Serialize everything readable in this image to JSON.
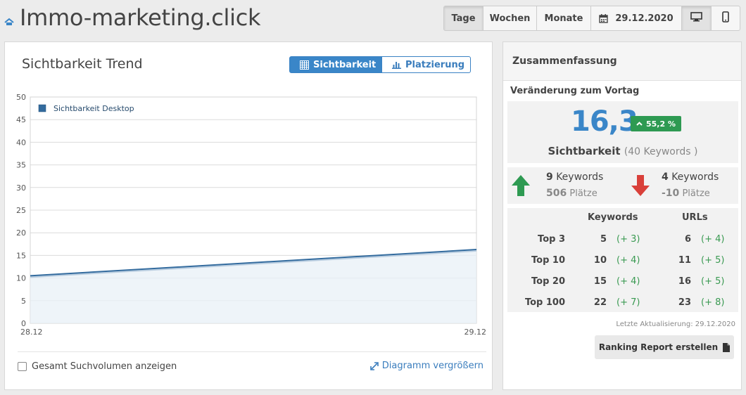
{
  "header": {
    "title": "Immo-marketing.click",
    "tabs": [
      "Tage",
      "Wochen",
      "Monate"
    ],
    "active_tab": "Tage",
    "date": "29.12.2020",
    "device_desktop_icon": "desktop-icon",
    "device_mobile_icon": "mobile-icon",
    "calendar_icon": "calendar-icon"
  },
  "trend": {
    "title": "Sichtbarkeit Trend",
    "toggle_visibility": "Sichtbarkeit",
    "toggle_ranking": "Platzierung",
    "show_volume_label": "Gesamt Suchvolumen anzeigen",
    "enlarge_label": "Diagramm vergrößern"
  },
  "chart_data": {
    "type": "area",
    "x": [
      "28.12",
      "29.12"
    ],
    "series": [
      {
        "name": "Sichtbarkeit Desktop",
        "values": [
          10.5,
          16.3
        ]
      }
    ],
    "yticks": [
      0,
      5,
      10,
      15,
      20,
      25,
      30,
      35,
      40,
      45,
      50
    ],
    "ylim": [
      0,
      50
    ],
    "grid": true,
    "legend": "top-left",
    "color": "#336b9e"
  },
  "summary": {
    "title": "Zusammenfassung",
    "subtitle": "Veränderung zum Vortag",
    "value": "16,3",
    "change": "55,2 %",
    "metric": "Sichtbarkeit",
    "keywords_total": "(40 Keywords )",
    "up_count": "9",
    "up_keywords_label": "Keywords",
    "up_places": "506",
    "down_count": "4",
    "down_keywords_label": "Keywords",
    "down_places": "-10",
    "places_label": "Plätze",
    "col_keywords": "Keywords",
    "col_urls": "URLs",
    "rows": [
      {
        "label": "Top 3",
        "k": "5",
        "kd": "(+ 3)",
        "u": "6",
        "ud": "(+ 4)"
      },
      {
        "label": "Top 10",
        "k": "10",
        "kd": "(+ 4)",
        "u": "11",
        "ud": "(+ 5)"
      },
      {
        "label": "Top 20",
        "k": "15",
        "kd": "(+ 4)",
        "u": "16",
        "ud": "(+ 5)"
      },
      {
        "label": "Top 100",
        "k": "22",
        "kd": "(+ 7)",
        "u": "23",
        "ud": "(+ 8)"
      }
    ],
    "updated": "Letzte Aktualisierung: 29.12.2020",
    "report_button": "Ranking Report erstellen",
    "colors": {
      "accent": "#3a86c8",
      "positive": "#2e9a52",
      "negative": "#d9403a"
    }
  }
}
